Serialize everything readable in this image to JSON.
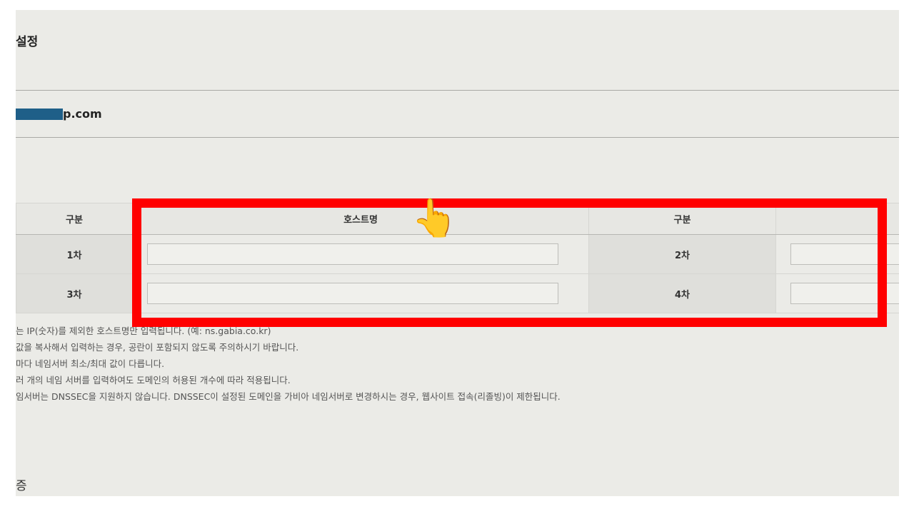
{
  "section": {
    "title": "설정"
  },
  "domain": {
    "name_suffix": "p.com"
  },
  "table": {
    "headers": [
      "구분",
      "호스트명",
      "구분",
      ""
    ],
    "rows": [
      {
        "label_a": "1차",
        "value_a": "",
        "label_b": "2차",
        "value_b": ""
      },
      {
        "label_a": "3차",
        "value_a": "",
        "label_b": "4차",
        "value_b": ""
      }
    ]
  },
  "notes": [
    "는 IP(숫자)를 제외한 호스트명만 입력됩니다. (예: ns.gabia.co.kr)",
    "값을 복사해서 입력하는 경우, 공란이 포함되지 않도록 주의하시기 바랍니다.",
    "마다 네임서버 최소/최대 값이 다릅니다.",
    "러 개의 네임 서버를 입력하여도 도메인의 허용된 개수에 따라 적용됩니다.",
    "임서버는 DNSSEC을 지원하지 않습니다. DNSSEC이 설정된 도메인을 가비아 네임서버로 변경하시는 경우, 웹사이트 접속(리졸빙)이 제한됩니다."
  ],
  "bottom": {
    "label": "증"
  },
  "overlay": {
    "highlight_color": "#ff0000",
    "pointer": "👆"
  }
}
